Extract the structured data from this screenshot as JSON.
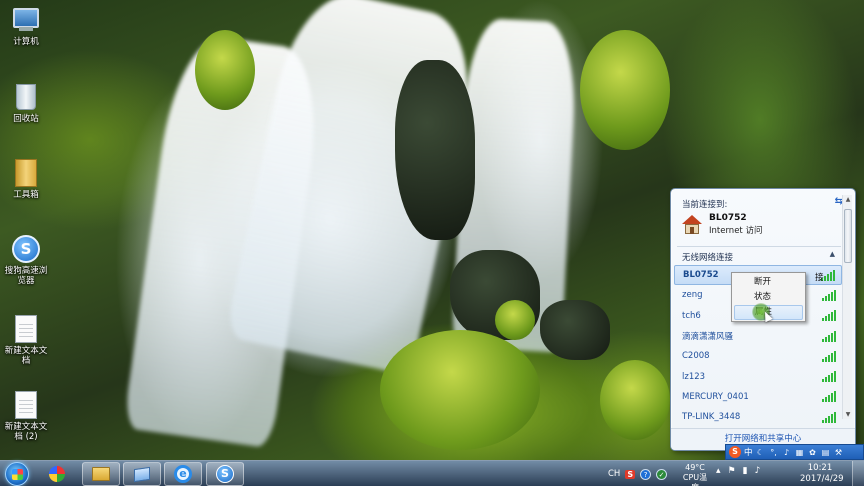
{
  "desktop": {
    "icons": [
      {
        "label": "计算机",
        "icon": "computer-icon"
      },
      {
        "label": "回收站",
        "icon": "recycle-bin-icon"
      },
      {
        "label": "工具箱",
        "icon": "folder-icon"
      },
      {
        "label": "搜狗高速浏览器",
        "icon": "sogou-browser-icon"
      },
      {
        "label": "新建文本文档",
        "icon": "text-document-icon"
      },
      {
        "label": "新建文本文档 (2)",
        "icon": "text-document-icon"
      }
    ]
  },
  "network_panel": {
    "current_heading": "当前连接到:",
    "current_network": {
      "name": "BL0752",
      "status": "Internet 访问"
    },
    "section_title": "无线网络连接",
    "networks": [
      {
        "name": "BL0752",
        "selected": true,
        "signal": 5
      },
      {
        "name": "zeng",
        "selected": false,
        "signal": 5
      },
      {
        "name": "tch6",
        "selected": false,
        "signal": 5
      },
      {
        "name": "滴滴潇潇风骚",
        "selected": false,
        "signal": 5
      },
      {
        "name": "C2008",
        "selected": false,
        "signal": 5
      },
      {
        "name": "lz123",
        "selected": false,
        "signal": 5
      },
      {
        "name": "MERCURY_0401",
        "selected": false,
        "signal": 5
      },
      {
        "name": "TP-LINK_3448",
        "selected": false,
        "signal": 5
      }
    ],
    "selected_trailing_text": "接",
    "footer_link": "打开网络和共享中心"
  },
  "context_menu": {
    "items": [
      {
        "label": "断开",
        "hover": false
      },
      {
        "label": "状态",
        "hover": false
      },
      {
        "label": "属性",
        "hover": true
      }
    ]
  },
  "ime_bar": {
    "logo": "S",
    "mode": "中"
  },
  "taskbar": {
    "apps": [
      "paint",
      "file-explorer",
      "window",
      "internet-explorer",
      "sogou-browser"
    ],
    "tray": {
      "lang": "CH",
      "cpu_temp": "49°C",
      "cpu_label": "CPU温度",
      "time": "10:21",
      "date": "2017/4/29"
    }
  },
  "colors": {
    "taskbar_accent": "#1f5fb6",
    "link": "#1f56b3",
    "signal": "#2fb83a"
  }
}
